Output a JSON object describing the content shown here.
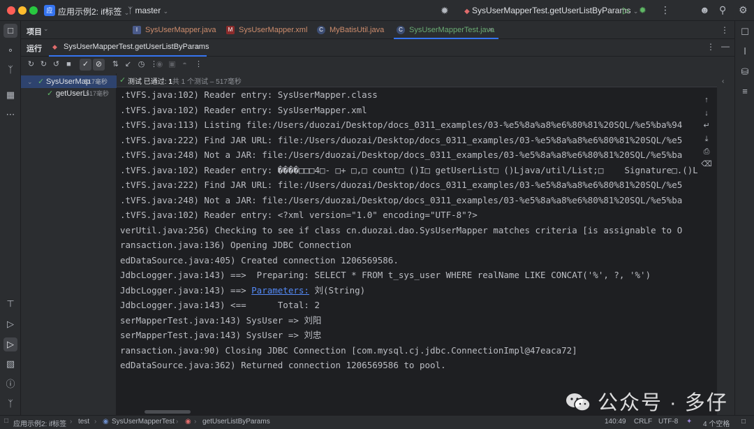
{
  "titlebar": {
    "project_badge": "应",
    "project": "应用示例2: if标签",
    "branch": "master",
    "run_config": "SysUserMapperTest.getUserListByParams"
  },
  "projbar": {
    "label": "项目"
  },
  "tabs": [
    {
      "label": "SysUserMapper.java",
      "icon": "java-interface-icon"
    },
    {
      "label": "SysUserMapper.xml",
      "icon": "mybatis-xml-icon"
    },
    {
      "label": "MyBatisUtil.java",
      "icon": "java-class-icon"
    },
    {
      "label": "SysUserMapperTest.java",
      "icon": "java-test-icon",
      "active": true
    }
  ],
  "run": {
    "panel_label": "运行",
    "tab_label": "SysUserMapperTest.getUserListByParams"
  },
  "tree": {
    "root": {
      "label": "SysUserMap",
      "duration": "517毫秒"
    },
    "child": {
      "label": "getUserLi",
      "duration": "517毫秒"
    }
  },
  "test_status": {
    "prefix": "测试 已通过: ",
    "count": "1",
    "detail": "共 1 个测试 – 517毫秒"
  },
  "console_lines": [
    {
      "text": ".tVFS.java:102) Reader entry: SysUserMapper.class"
    },
    {
      "text": ".tVFS.java:102) Reader entry: SysUserMapper.xml"
    },
    {
      "text": ".tVFS.java:113) Listing file:/Users/duozai/Desktop/docs_0311_examples/03-%e5%8a%a8%e6%80%81%20SQL/%e5%ba%94"
    },
    {
      "text": ".tVFS.java:222) Find JAR URL: file:/Users/duozai/Desktop/docs_0311_examples/03-%e5%8a%a8%e6%80%81%20SQL/%e5"
    },
    {
      "text": ".tVFS.java:248) Not a JAR: file:/Users/duozai/Desktop/docs_0311_examples/03-%e5%8a%a8%e6%80%81%20SQL/%e5%ba"
    },
    {
      "text": ".tVFS.java:102) Reader entry: ����□□□4□- □+ □,□ count□ ()I□ getUserList□ ()Ljava/util/List;□    Signature□.()L"
    },
    {
      "text": ".tVFS.java:222) Find JAR URL: file:/Users/duozai/Desktop/docs_0311_examples/03-%e5%8a%a8%e6%80%81%20SQL/%e5"
    },
    {
      "text": ".tVFS.java:248) Not a JAR: file:/Users/duozai/Desktop/docs_0311_examples/03-%e5%8a%a8%e6%80%81%20SQL/%e5%ba"
    },
    {
      "text": ".tVFS.java:102) Reader entry: <?xml version=\"1.0\" encoding=\"UTF-8\"?>"
    },
    {
      "text": "verUtil.java:256) Checking to see if class cn.duozai.dao.SysUserMapper matches criteria [is assignable to O"
    },
    {
      "text": "ransaction.java:136) Opening JDBC Connection"
    },
    {
      "text": "edDataSource.java:405) Created connection 1206569586."
    },
    {
      "text": "JdbcLogger.java:143) ==>  Preparing: SELECT * FROM t_sys_user WHERE realName LIKE CONCAT('%', ?, '%')"
    },
    {
      "text": "JdbcLogger.java:143) ==> ",
      "link": "Parameters:",
      "after": " 刘(String)"
    },
    {
      "text": "JdbcLogger.java:143) <==      Total: 2"
    },
    {
      "text": "serMapperTest.java:143) SysUser => 刘阳"
    },
    {
      "text": "serMapperTest.java:143) SysUser => 刘忠"
    },
    {
      "text": "ransaction.java:90) Closing JDBC Connection [com.mysql.cj.jdbc.ConnectionImpl@47eaca72]"
    },
    {
      "text": "edDataSource.java:362) Returned connection 1206569586 to pool."
    }
  ],
  "statusbar": {
    "crumbs": [
      "应用示例2: if标签",
      "test",
      "SysUserMapperTest",
      "getUserListByParams"
    ],
    "position": "140:49",
    "line_sep": "CRLF",
    "encoding": "UTF-8",
    "indent": "4 个空格"
  },
  "watermark": "公众号 · 多仔",
  "colors": {
    "accent": "#3574f0",
    "pass": "#5fb865",
    "link": "#548af7"
  }
}
